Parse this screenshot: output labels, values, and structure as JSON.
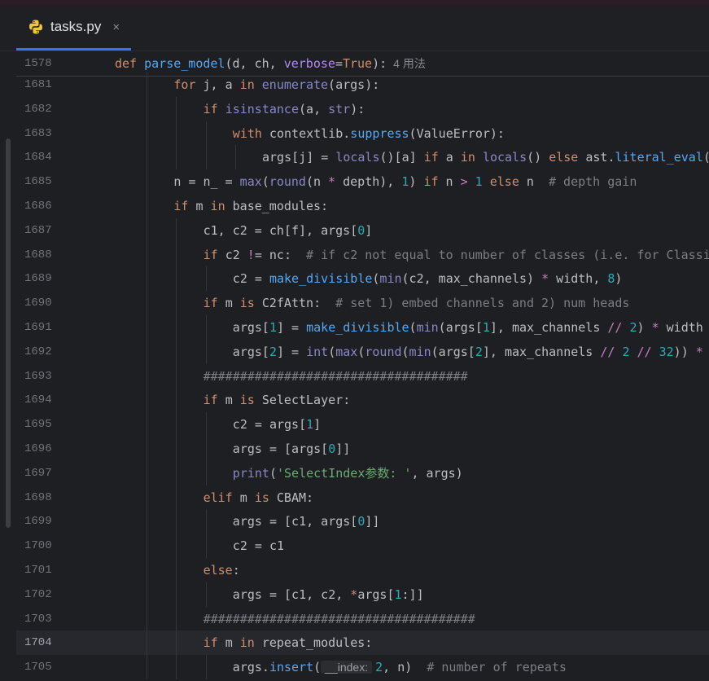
{
  "tab": {
    "file_name": "tasks.py",
    "close_glyph": "×",
    "icon": "python-file-icon"
  },
  "sticky": {
    "line_number": "1578",
    "usages_hint": "4 用法"
  },
  "current_line": "1704",
  "colors": {
    "keyword": "#cf8e6d",
    "function": "#56a8f5",
    "builtin": "#8888c6",
    "number": "#2aacb8",
    "string": "#6aab73",
    "comment": "#7a7e85",
    "param": "#b189f5",
    "default": "#bcbec4",
    "operator": "#c77dbb"
  },
  "lines": [
    {
      "n": "1681",
      "indent": 2,
      "text": "for j, a in enumerate(args):"
    },
    {
      "n": "1682",
      "indent": 3,
      "text": "if isinstance(a, str):"
    },
    {
      "n": "1683",
      "indent": 4,
      "text": "with contextlib.suppress(ValueError):"
    },
    {
      "n": "1684",
      "indent": 5,
      "text": "args[j] = locals()[a] if a in locals() else ast.literal_eval("
    },
    {
      "n": "1685",
      "indent": 2,
      "text": "n = n_ = max(round(n * depth), 1) if n > 1 else n  # depth gain"
    },
    {
      "n": "1686",
      "indent": 2,
      "text": "if m in base_modules:"
    },
    {
      "n": "1687",
      "indent": 3,
      "text": "c1, c2 = ch[f], args[0]"
    },
    {
      "n": "1688",
      "indent": 3,
      "text": "if c2 != nc:  # if c2 not equal to number of classes (i.e. for Classi"
    },
    {
      "n": "1689",
      "indent": 4,
      "text": "c2 = make_divisible(min(c2, max_channels) * width, 8)"
    },
    {
      "n": "1690",
      "indent": 3,
      "text": "if m is C2fAttn:  # set 1) embed channels and 2) num heads"
    },
    {
      "n": "1691",
      "indent": 4,
      "text": "args[1] = make_divisible(min(args[1], max_channels // 2) * width"
    },
    {
      "n": "1692",
      "indent": 4,
      "text": "args[2] = int(max(round(min(args[2], max_channels // 2 // 32)) *"
    },
    {
      "n": "1693",
      "indent": 3,
      "text": "####################################"
    },
    {
      "n": "1694",
      "indent": 3,
      "text": "if m is SelectLayer:"
    },
    {
      "n": "1695",
      "indent": 4,
      "text": "c2 = args[1]"
    },
    {
      "n": "1696",
      "indent": 4,
      "text": "args = [args[0]]"
    },
    {
      "n": "1697",
      "indent": 4,
      "text": "print('SelectIndex参数: ', args)"
    },
    {
      "n": "1698",
      "indent": 3,
      "text": "elif m is CBAM:"
    },
    {
      "n": "1699",
      "indent": 4,
      "text": "args = [c1, args[0]]"
    },
    {
      "n": "1700",
      "indent": 4,
      "text": "c2 = c1"
    },
    {
      "n": "1701",
      "indent": 3,
      "text": "else:"
    },
    {
      "n": "1702",
      "indent": 4,
      "text": "args = [c1, c2, *args[1:]]"
    },
    {
      "n": "1703",
      "indent": 3,
      "text": "#####################################"
    },
    {
      "n": "1704",
      "indent": 3,
      "text": "if m in repeat_modules:"
    },
    {
      "n": "1705",
      "indent": 4,
      "text": "args.insert(",
      "inlay": "__index:",
      "rest": "2, n)  # number of repeats"
    }
  ],
  "sticky_code": "def parse_model(d, ch, verbose=True):"
}
